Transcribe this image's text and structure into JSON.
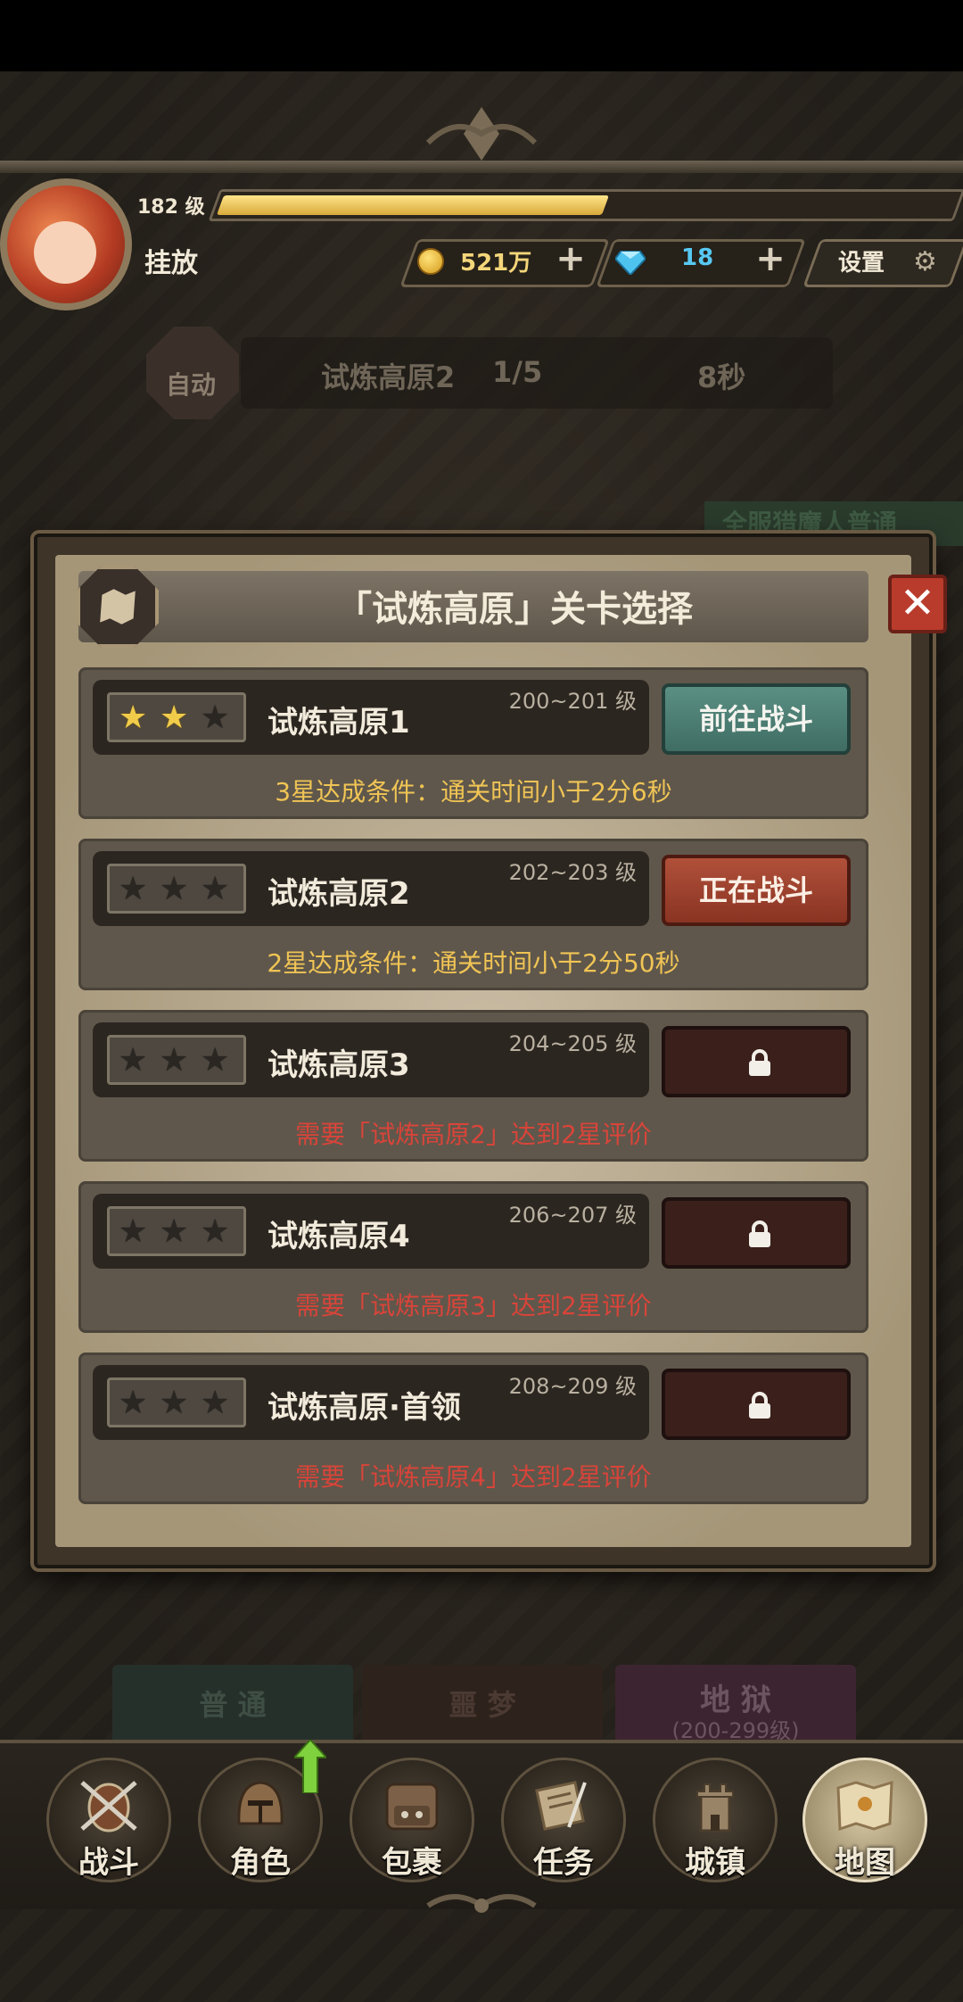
{
  "player": {
    "level_text": "182 级",
    "xp_fraction": 0.52,
    "name": "挂放",
    "gold": "521万",
    "gems": "18",
    "settings_label": "设置"
  },
  "auto_bar": {
    "auto_label": "自动",
    "stage": "试炼高原2",
    "progress": "1/5",
    "timer": "8秒"
  },
  "side_banner": "全服猎魔人普通",
  "dialog": {
    "title": "「试炼高原」关卡选择",
    "close_label": "✕",
    "stages": [
      {
        "name": "试炼高原1",
        "level": "200~201 级",
        "stars": 2,
        "action": "前往战斗",
        "state": "go",
        "condition": "3星达成条件：通关时间小于2分6秒",
        "cond_color": "yellow"
      },
      {
        "name": "试炼高原2",
        "level": "202~203 级",
        "stars": 0,
        "action": "正在战斗",
        "state": "fighting",
        "condition": "2星达成条件：通关时间小于2分50秒",
        "cond_color": "yellow"
      },
      {
        "name": "试炼高原3",
        "level": "204~205 级",
        "stars": 0,
        "action": "",
        "state": "locked",
        "condition": "需要「试炼高原2」达到2星评价",
        "cond_color": "red"
      },
      {
        "name": "试炼高原4",
        "level": "206~207 级",
        "stars": 0,
        "action": "",
        "state": "locked",
        "condition": "需要「试炼高原3」达到2星评价",
        "cond_color": "red"
      },
      {
        "name": "试炼高原·首领",
        "level": "208~209 级",
        "stars": 0,
        "action": "",
        "state": "locked",
        "condition": "需要「试炼高原4」达到2星评价",
        "cond_color": "red"
      }
    ]
  },
  "mode_tabs": {
    "normal": "普 通",
    "nightmare": "噩 梦",
    "hell": "地 狱",
    "hell_range": "(200-299级)"
  },
  "nav": [
    {
      "label": "战斗",
      "icon": "battle-icon"
    },
    {
      "label": "角色",
      "icon": "helmet-icon"
    },
    {
      "label": "包裹",
      "icon": "backpack-icon"
    },
    {
      "label": "任务",
      "icon": "scroll-icon"
    },
    {
      "label": "城镇",
      "icon": "tower-icon"
    },
    {
      "label": "地图",
      "icon": "map-icon"
    }
  ],
  "colors": {
    "go_button": "#4a7b70",
    "fighting_button": "#9b412e",
    "locked_button": "#3a1f1b",
    "condition_yellow": "#f0c455",
    "condition_red": "#d9443a"
  }
}
